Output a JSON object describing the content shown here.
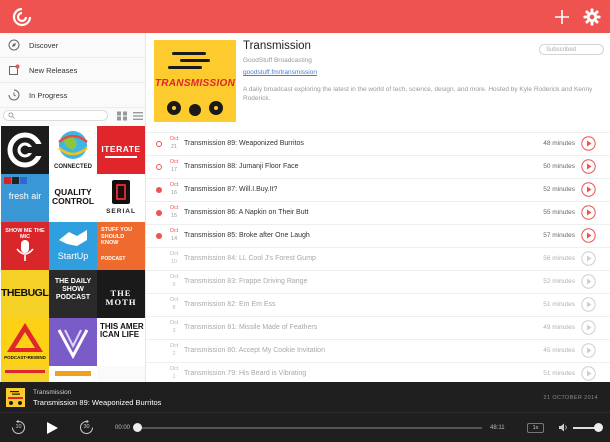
{
  "app": {
    "accent": "#ef5350"
  },
  "nav": [
    {
      "label": "Discover",
      "icon": "compass-icon"
    },
    {
      "label": "New Releases",
      "icon": "new-releases-icon"
    },
    {
      "label": "In Progress",
      "icon": "in-progress-icon"
    }
  ],
  "search": {
    "placeholder": ""
  },
  "tiles": [
    {
      "name": "comedy-central",
      "text": "",
      "bg": "#1c1c1c"
    },
    {
      "name": "connected",
      "text": "CONNECTED",
      "bg": "#ffffff"
    },
    {
      "name": "iterate",
      "text": "ITERATE",
      "bg": "#e0262b"
    },
    {
      "name": "fresh-air",
      "text": "fresh air",
      "bg": "#3a97d5"
    },
    {
      "name": "quality-control",
      "text": "QUALITY CONTROL",
      "bg": "#ffffff"
    },
    {
      "name": "serial",
      "text": "SERIAL",
      "bg": "#ffffff"
    },
    {
      "name": "show-me-the-mic",
      "text": "SHOW ME THE MIC",
      "bg": "#d9262b"
    },
    {
      "name": "startup",
      "text": "StartUp",
      "bg": "#2f9fe0"
    },
    {
      "name": "stuff-you-should-know",
      "text": "STUFF YOU SHOULD KNOW",
      "bg": "#ef6b2d"
    },
    {
      "name": "the-bugle",
      "text": "THEBUGLE",
      "bg": "#f5d127"
    },
    {
      "name": "daily-show-podcast",
      "text": "THE DAILY SHOW PODCAST",
      "bg": "#2a2a2a"
    },
    {
      "name": "the-moth",
      "text": "THE MOTH",
      "bg": "#1a1a1a"
    },
    {
      "name": "podcast-rewind",
      "text": "PODCAST•REWIND",
      "bg": "#fcd116"
    },
    {
      "name": "the-verge",
      "text": "",
      "bg": "#7a5bc8"
    },
    {
      "name": "this-american-life",
      "text": "THIS AMER ICAN LIFE",
      "bg": "#ffffff"
    }
  ],
  "podcast": {
    "title": "Transmission",
    "author": "GoodStuff Broadcasting",
    "link": "goodstuff.fm/transmission",
    "description": "A daily broadcast exploring the latest in the world of tech, science, design, and more. Hosted by Kyle Roderick and Kenny Roderick.",
    "subscribe_label": "Subscribed",
    "art_text": "TRANSMISSION"
  },
  "episodes": [
    {
      "month": "Oct",
      "day": "21",
      "title": "Transmission 89: Weaponized Burritos",
      "duration": "48 minutes",
      "status": "playing"
    },
    {
      "month": "Oct",
      "day": "17",
      "title": "Transmission 88: Jumanji Floor Face",
      "duration": "50 minutes",
      "status": "playing"
    },
    {
      "month": "Oct",
      "day": "16",
      "title": "Transmission 87: Will.I.Buy.It?",
      "duration": "52 minutes",
      "status": "unplayed"
    },
    {
      "month": "Oct",
      "day": "15",
      "title": "Transmission 86: A Napkin on Their Butt",
      "duration": "55 minutes",
      "status": "unplayed"
    },
    {
      "month": "Oct",
      "day": "14",
      "title": "Transmission 85: Broke after One Laugh",
      "duration": "57 minutes",
      "status": "unplayed"
    },
    {
      "month": "Oct",
      "day": "10",
      "title": "Transmission 84: LL Cool J's Forest Gump",
      "duration": "56 minutes",
      "status": "played"
    },
    {
      "month": "Oct",
      "day": "9",
      "title": "Transmission 83: Frappe Driving Range",
      "duration": "52 minutes",
      "status": "played"
    },
    {
      "month": "Oct",
      "day": "8",
      "title": "Transmission 82: Em Em Ess",
      "duration": "51 minutes",
      "status": "played"
    },
    {
      "month": "Oct",
      "day": "3",
      "title": "Transmission 81: Missile Made of Feathers",
      "duration": "49 minutes",
      "status": "played"
    },
    {
      "month": "Oct",
      "day": "2",
      "title": "Transmission 80: Accept My Cookie Invitation",
      "duration": "45 minutes",
      "status": "played"
    },
    {
      "month": "Oct",
      "day": "1",
      "title": "Transmission 79: His Beard is Vibrating",
      "duration": "51 minutes",
      "status": "played"
    }
  ],
  "player": {
    "podcast": "Transmission",
    "episode": "Transmission 89: Weaponized Burritos",
    "date": "21 OCTOBER 2014",
    "skip_back": "10",
    "skip_forward": "30",
    "current_time": "00:00",
    "remaining_time": "48:11",
    "speed": "1x",
    "progress": 0.0,
    "volume": 1.0
  }
}
